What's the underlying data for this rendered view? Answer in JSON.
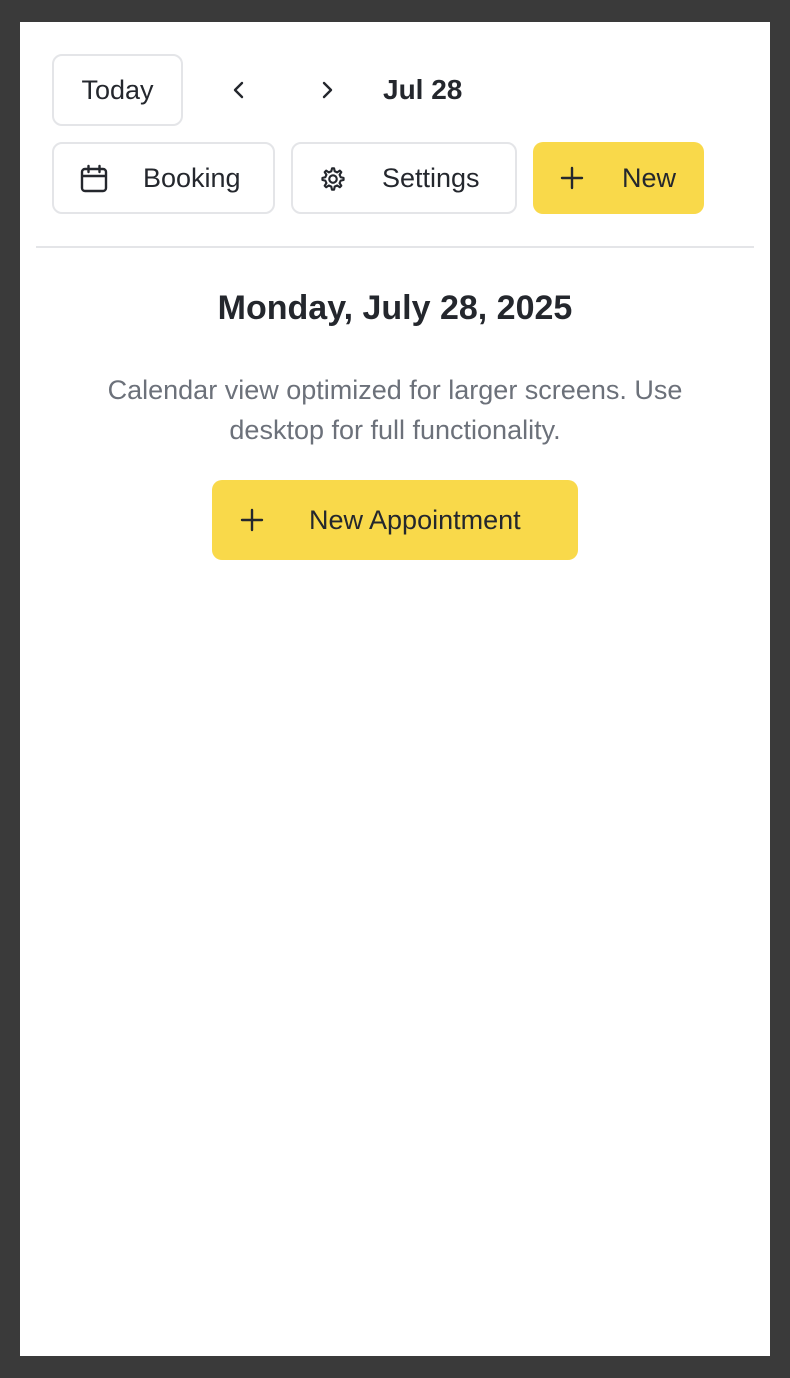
{
  "toolbar": {
    "today_label": "Today",
    "prev_icon": "chevron-left-icon",
    "next_icon": "chevron-right-icon",
    "current_date": "Jul 28",
    "booking_label": "Booking",
    "booking_icon": "calendar-icon",
    "settings_label": "Settings",
    "settings_icon": "gear-icon",
    "new_label": "New",
    "new_icon": "plus-icon"
  },
  "main": {
    "day_title": "Monday, July 28, 2025",
    "notice": "Calendar view optimized for larger screens. Use desktop for full functionality.",
    "new_appointment_label": "New Appointment",
    "new_appointment_icon": "plus-icon"
  },
  "colors": {
    "accent": "#f9d94a",
    "text": "#24272d",
    "muted_text": "#6c717a",
    "border": "#e4e5e8",
    "outer_background": "#3a3a3a"
  }
}
